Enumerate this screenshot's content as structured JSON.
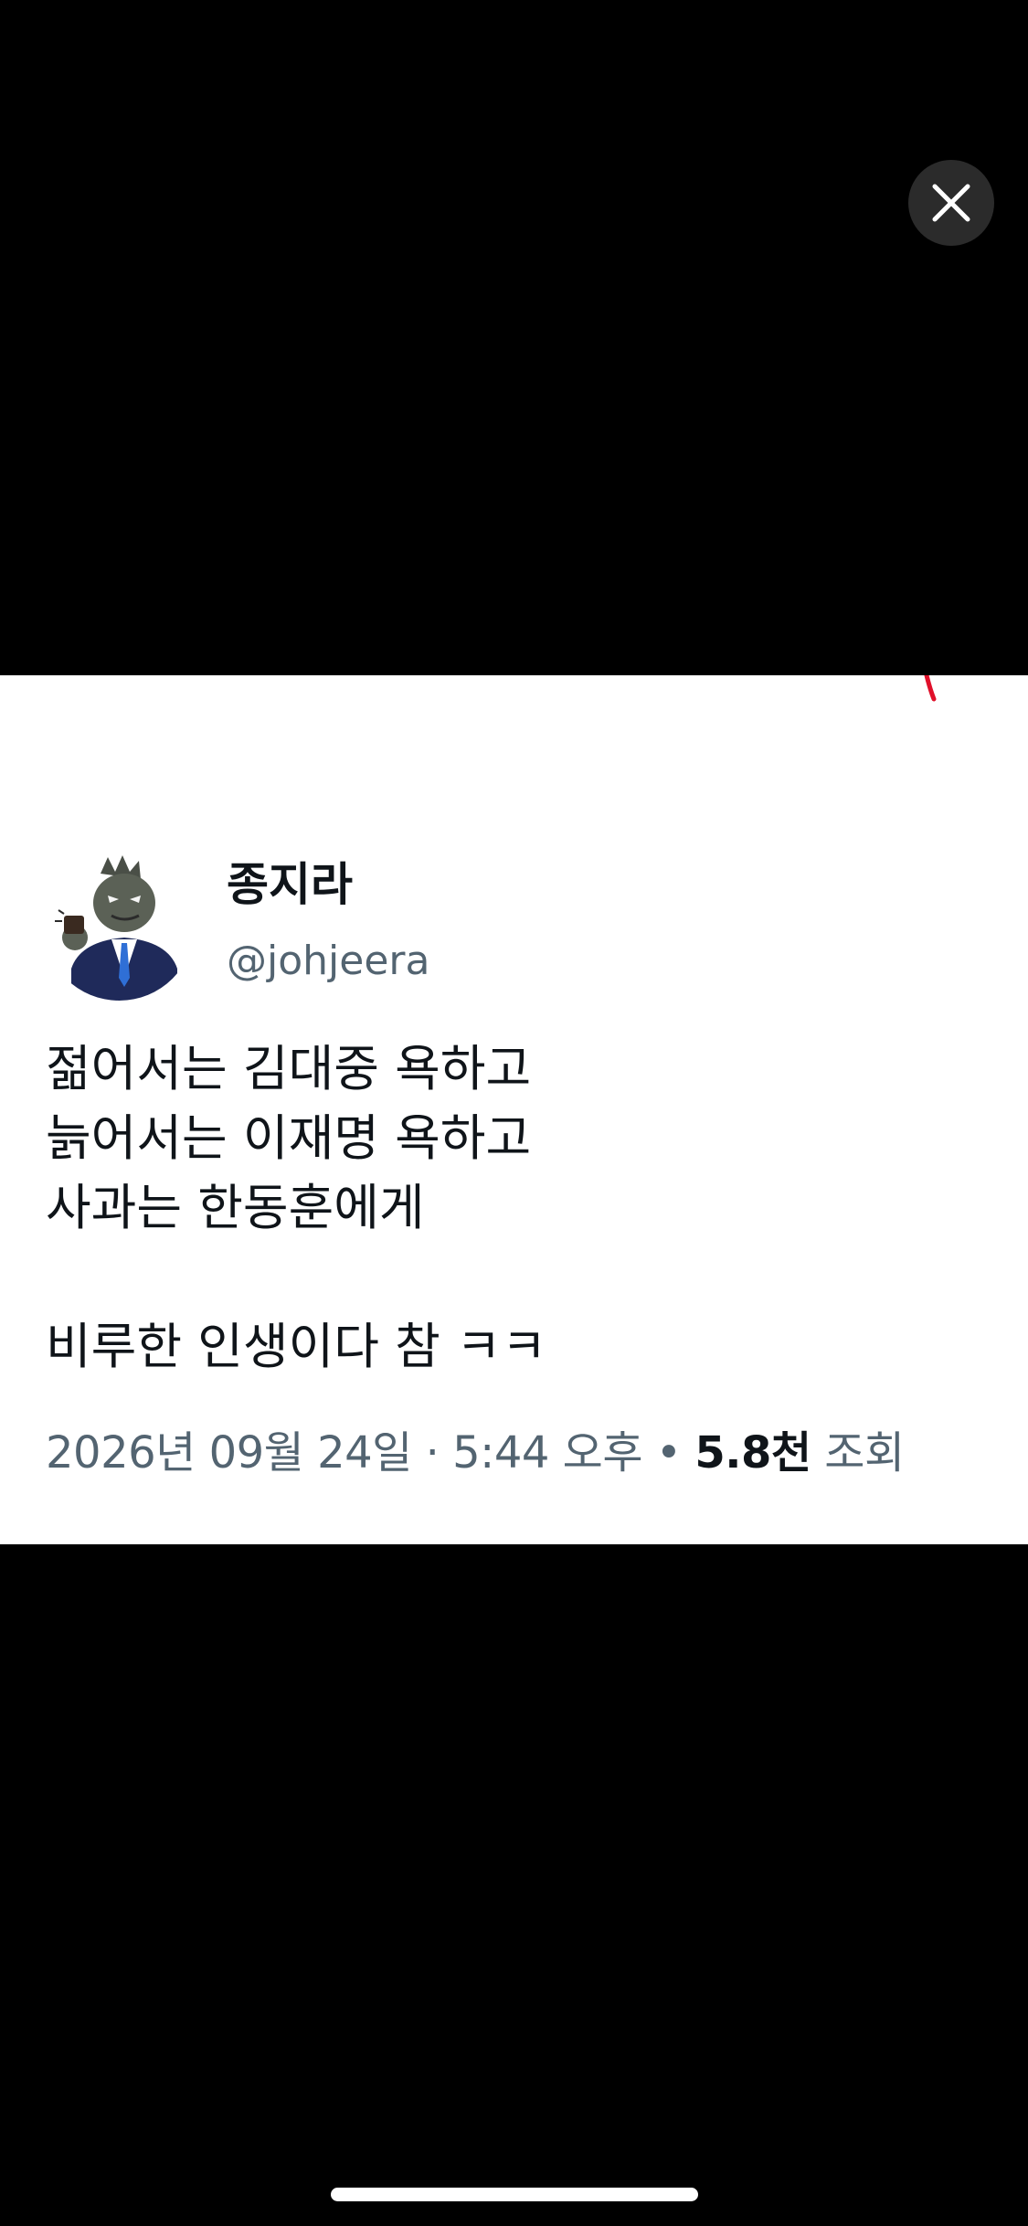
{
  "viewer": {
    "close_icon": "close-icon"
  },
  "tweet": {
    "author": {
      "display_name": "종지라",
      "handle": "@johjeera",
      "avatar_icon": "godzilla-businessman-avatar"
    },
    "lines": [
      "젊어서는 김대중 욕하고",
      "늙어서는 이재명 욕하고",
      "사과는 한동훈에게",
      "",
      "비루한 인생이다 참 ㅋㅋ"
    ],
    "meta": {
      "date": "2026년 09월 24일",
      "separator": "·",
      "time": "5:44 오후",
      "bullet": "•",
      "views_count": "5.8천",
      "views_label": "조회"
    }
  },
  "colors": {
    "background": "#000000",
    "card": "#ffffff",
    "primary_text": "#0f1419",
    "secondary_text": "#536471",
    "mark": "#e0102a"
  }
}
